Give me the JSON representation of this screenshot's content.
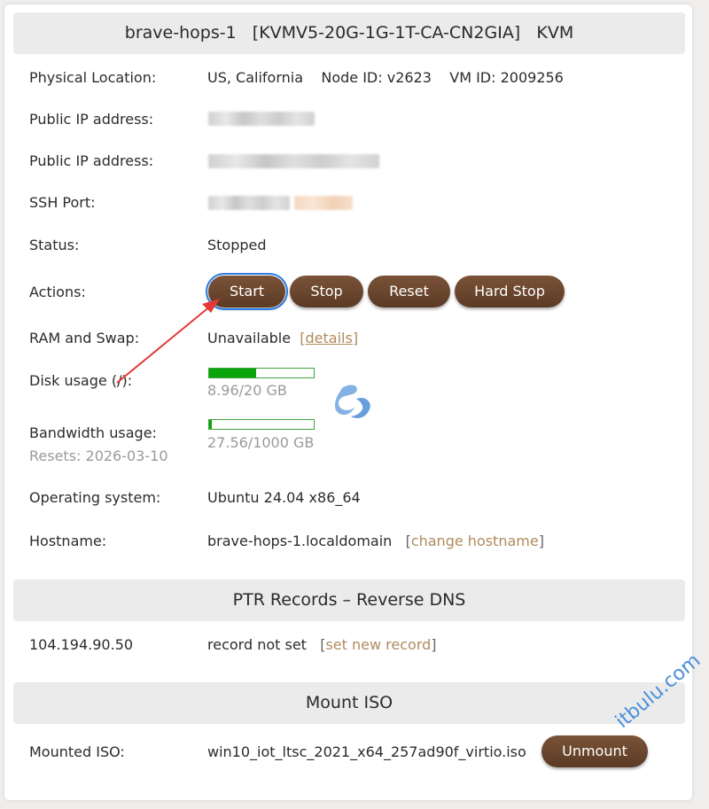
{
  "server": {
    "title_name": "brave-hops-1",
    "title_plan": "[KVMV5-20G-1G-1T-CA-CN2GIA]",
    "title_type": "KVM"
  },
  "rows": {
    "location_label": "Physical Location:",
    "location_value": "US, California",
    "node_id": "Node ID: v2623",
    "vm_id": "VM ID: 2009256",
    "ip4_label": "Public IP address:",
    "ip6_label": "Public IP address:",
    "ssh_label": "SSH Port:",
    "status_label": "Status:",
    "status_value": "Stopped",
    "actions_label": "Actions:",
    "ram_label": "RAM and Swap:",
    "ram_value": "Unavailable",
    "ram_link_open": "[",
    "ram_link": "details",
    "ram_link_close": "]",
    "disk_label": "Disk usage (/):",
    "disk_value": "8.96/20 GB",
    "bw_label": "Bandwidth usage:",
    "bw_resets": "Resets: 2026-03-10",
    "bw_value": "27.56/1000 GB",
    "os_label": "Operating system:",
    "os_value": "Ubuntu 24.04 x86_64",
    "hostname_label": "Hostname:",
    "hostname_value": "brave-hops-1.localdomain",
    "hostname_link": "change hostname"
  },
  "usage": {
    "disk_fraction": 0.448,
    "bw_fraction": 0.02756
  },
  "actions": {
    "start": "Start",
    "stop": "Stop",
    "reset": "Reset",
    "hard_stop": "Hard Stop"
  },
  "ptr": {
    "title": "PTR Records – Reverse DNS",
    "ip": "104.194.90.50",
    "value": "record not set",
    "link": "set new record"
  },
  "iso": {
    "title": "Mount ISO",
    "label": "Mounted ISO:",
    "value": "win10_iot_ltsc_2021_x64_257ad90f_virtio.iso",
    "unmount": "Unmount"
  },
  "watermark": "itbulu.com",
  "colors": {
    "button": "#5b3a24",
    "link": "#b08a5c",
    "progress": "#0aa50a",
    "focus_ring": "#2d7be5",
    "annotation_arrow": "#e53935"
  }
}
